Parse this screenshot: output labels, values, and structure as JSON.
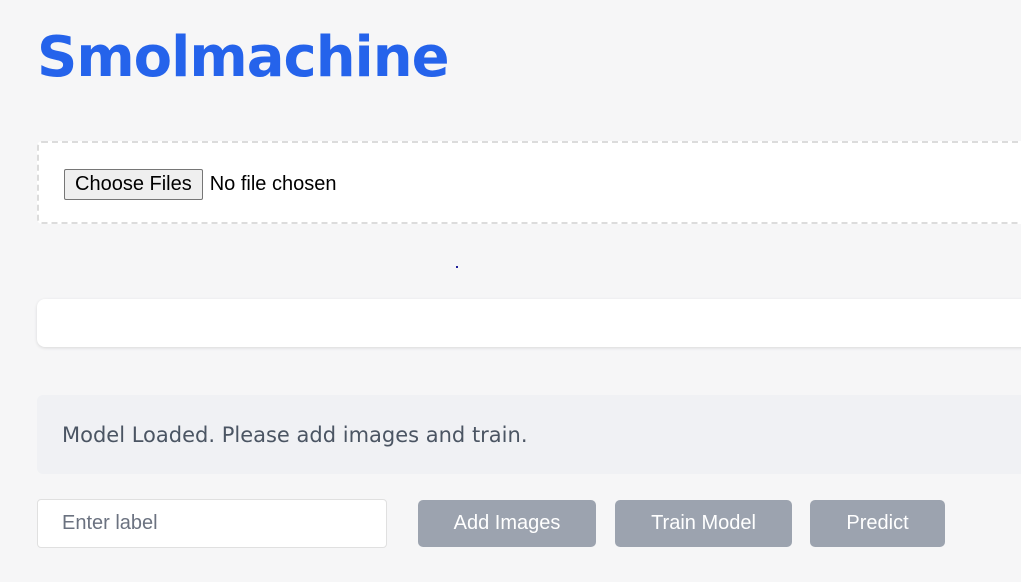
{
  "app": {
    "title": "Smolmachine"
  },
  "upload": {
    "choose_label": "Choose Files",
    "no_file_text": "No file chosen"
  },
  "status": {
    "message": "Model Loaded. Please add images and train."
  },
  "controls": {
    "label_placeholder": "Enter label",
    "label_value": "",
    "add_images_label": "Add Images",
    "train_model_label": "Train Model",
    "predict_label": "Predict"
  },
  "colors": {
    "title": "#2563eb",
    "button_bg": "#9ca3af",
    "status_bg": "#f0f1f4",
    "page_bg": "#f6f6f7"
  }
}
